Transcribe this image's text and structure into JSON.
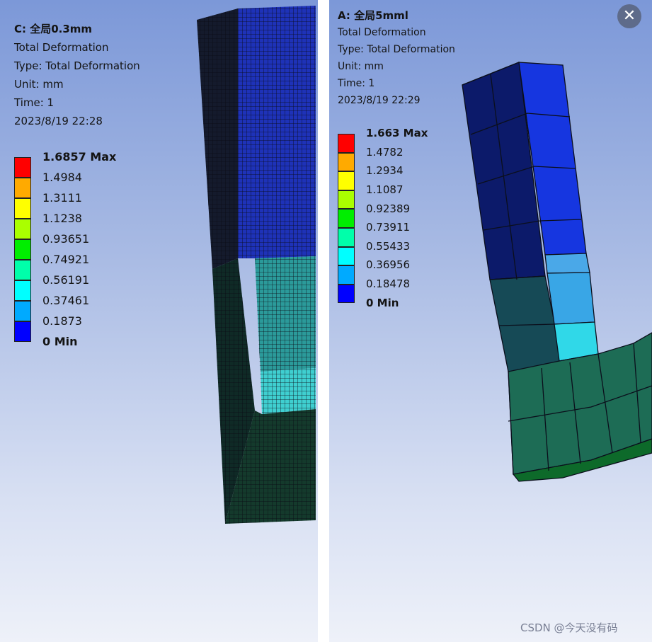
{
  "panel_c": {
    "title": "C: 全局0.3mm",
    "result_name": "Total Deformation",
    "type_line": "Type: Total Deformation",
    "unit_line": "Unit: mm",
    "time_line": "Time: 1",
    "timestamp": "2023/8/19 22:28",
    "legend": {
      "max_label": "1.6857 Max",
      "labels": [
        "1.4984",
        "1.3111",
        "1.1238",
        "0.93651",
        "0.74921",
        "0.56191",
        "0.37461",
        "0.1873"
      ],
      "min_label": "0 Min"
    }
  },
  "panel_a": {
    "title": "A: 全局5mml",
    "result_name": "Total Deformation",
    "type_line": "Type: Total Deformation",
    "unit_line": "Unit: mm",
    "time_line": "Time: 1",
    "timestamp": "2023/8/19 22:29",
    "legend": {
      "max_label": "1.663 Max",
      "labels": [
        "1.4782",
        "1.2934",
        "1.1087",
        "0.92389",
        "0.73911",
        "0.55433",
        "0.36956",
        "0.18478"
      ],
      "min_label": "0 Min"
    }
  },
  "legend_colors": [
    "#ff0000",
    "#ffaa00",
    "#ffff00",
    "#aaff00",
    "#00ee00",
    "#00ffaa",
    "#00ffff",
    "#00aaff",
    "#0000ff"
  ],
  "close_button": {
    "icon": "close-icon",
    "glyph": "✕"
  },
  "watermark": "CSDN @今天没有码"
}
